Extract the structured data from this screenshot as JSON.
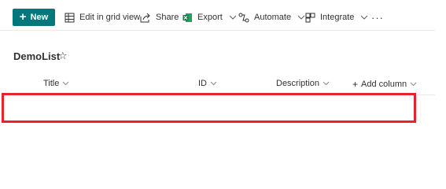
{
  "toolbar": {
    "new_label": "New",
    "edit_grid_label": "Edit in grid view",
    "share_label": "Share",
    "export_label": "Export",
    "automate_label": "Automate",
    "integrate_label": "Integrate",
    "more_label": "···"
  },
  "list": {
    "title": "DemoList",
    "favorite_glyph": "☆"
  },
  "columns": [
    {
      "label": "Title"
    },
    {
      "label": "ID"
    },
    {
      "label": "Description"
    },
    {
      "label": "Add column"
    }
  ],
  "colors": {
    "new_button": "#03787c",
    "highlight": "#e5242b",
    "excel_green": "#1e7145"
  }
}
